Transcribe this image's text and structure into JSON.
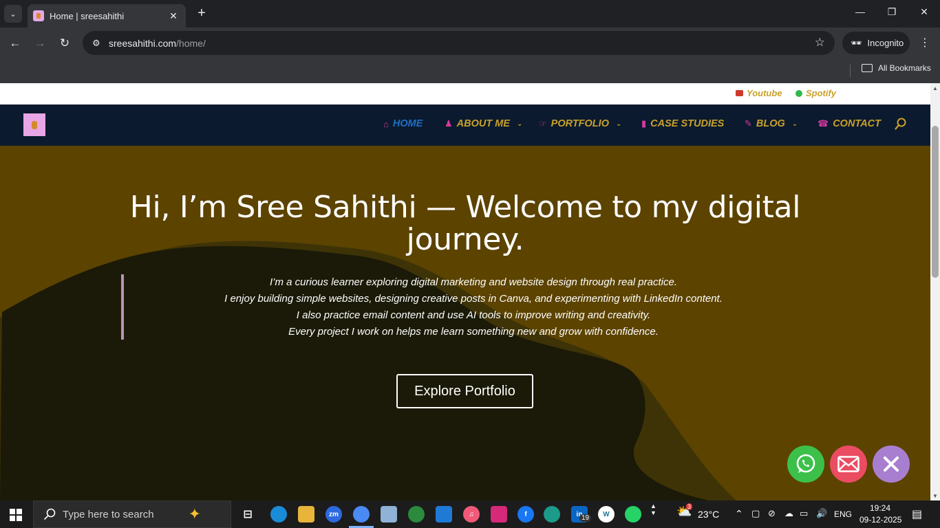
{
  "browser": {
    "tab_title": "Home | sreesahithi",
    "url_host": "sreesahithi.com",
    "url_path": "/home/",
    "incognito_label": "Incognito",
    "bookmarks_label": "All Bookmarks"
  },
  "topbar": {
    "links": [
      {
        "label": "Youtube",
        "icon": "youtube-icon"
      },
      {
        "label": "Spotify",
        "icon": "spotify-icon"
      }
    ]
  },
  "nav": {
    "items": [
      {
        "label": "HOME",
        "icon": "home-icon",
        "active": true
      },
      {
        "label": "ABOUT ME",
        "icon": "person-icon",
        "dropdown": true
      },
      {
        "label": "PORTFOLIO",
        "icon": "hand-pointer-icon",
        "dropdown": true
      },
      {
        "label": "CASE STUDIES",
        "icon": "book-icon"
      },
      {
        "label": "BLOG",
        "icon": "edit-icon",
        "dropdown": true
      },
      {
        "label": "CONTACT",
        "icon": "phone-icon"
      }
    ]
  },
  "hero": {
    "title": "Hi, I’m Sree Sahithi — Welcome to my digital journey.",
    "lines": [
      "I’m a curious learner exploring digital marketing and website design through real practice.",
      "I enjoy building simple websites, designing creative posts in Canva, and experimenting with LinkedIn content.",
      "I also practice email content and use AI tools to improve writing and creativity.",
      "Every project I work on helps me learn something new and grow with confidence."
    ],
    "cta_label": "Explore Portfolio"
  },
  "colors": {
    "hero_bg": "#5c4300",
    "hero_wave": "#1b1a08",
    "nav_bg": "#0b1a2e",
    "nav_text": "#c9a12a",
    "nav_active": "#1f6fc4",
    "nav_icon": "#d63aa0",
    "whatsapp": "#3cc04a",
    "email": "#ea4c62",
    "close": "#a87fd0"
  },
  "taskbar": {
    "search_placeholder": "Type here to search",
    "weather_badge": "3",
    "temperature": "23°C",
    "language": "ENG",
    "time": "19:24",
    "date": "09-12-2025",
    "linkedin_badge": "19"
  }
}
